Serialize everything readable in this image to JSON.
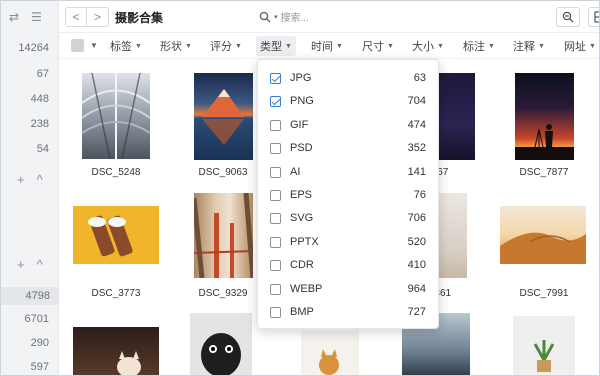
{
  "left": {
    "counts_a": [
      "14264",
      "67",
      "448",
      "238",
      "54"
    ],
    "counts_b": [
      "4798",
      "6701",
      "290",
      "597"
    ],
    "add_symbol": "+",
    "collapse_symbol": "^"
  },
  "header": {
    "back": "<",
    "forward": ">",
    "title": "摄影合集",
    "search_placeholder": "搜索..."
  },
  "filters": [
    "标签",
    "形状",
    "评分",
    "类型",
    "时间",
    "尺寸",
    "大小",
    "标注",
    "注释",
    "网址"
  ],
  "active_filter": "类型",
  "type_menu": [
    {
      "label": "JPG",
      "count": "63",
      "checked": true
    },
    {
      "label": "PNG",
      "count": "704",
      "checked": true
    },
    {
      "label": "GIF",
      "count": "474",
      "checked": false
    },
    {
      "label": "PSD",
      "count": "352",
      "checked": false
    },
    {
      "label": "AI",
      "count": "141",
      "checked": false
    },
    {
      "label": "EPS",
      "count": "76",
      "checked": false
    },
    {
      "label": "SVG",
      "count": "706",
      "checked": false
    },
    {
      "label": "PPTX",
      "count": "520",
      "checked": false
    },
    {
      "label": "CDR",
      "count": "410",
      "checked": false
    },
    {
      "label": "WEBP",
      "count": "964",
      "checked": false
    },
    {
      "label": "BMP",
      "count": "727",
      "checked": false
    }
  ],
  "captions": {
    "r1": [
      "DSC_5248",
      "DSC_9063",
      "467",
      "DSC_7877"
    ],
    "r2": [
      "DSC_3773",
      "DSC_9329",
      "9861",
      "DSC_7991"
    ]
  },
  "colors": {
    "accent": "#3a7bd5",
    "sidebar": "#f2f3f5"
  }
}
